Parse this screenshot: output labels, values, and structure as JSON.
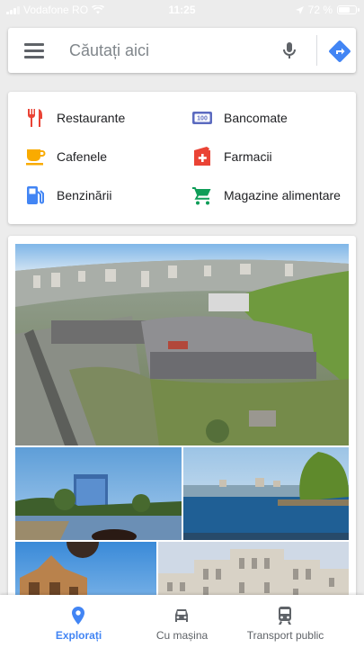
{
  "status_bar": {
    "carrier": "Vodafone RO",
    "time": "11:25",
    "battery_text": "72 %",
    "battery_level": 0.72
  },
  "search": {
    "placeholder": "Căutați aici",
    "icons": [
      "menu-icon",
      "microphone-icon",
      "directions-icon"
    ]
  },
  "categories": {
    "items": [
      {
        "label": "Restaurante",
        "icon": "restaurant-icon",
        "color": "#ea4335"
      },
      {
        "label": "Bancomate",
        "icon": "atm-icon",
        "color": "#5c6bc0"
      },
      {
        "label": "Cafenele",
        "icon": "coffee-icon",
        "color": "#f9ab00"
      },
      {
        "label": "Farmacii",
        "icon": "pharmacy-icon",
        "color": "#ea4335"
      },
      {
        "label": "Benzinării",
        "icon": "gas-station-icon",
        "color": "#4285f4"
      },
      {
        "label": "Magazine alimentare",
        "icon": "grocery-cart-icon",
        "color": "#0f9d58"
      }
    ]
  },
  "explore": {
    "photos": [
      {
        "name": "aerial-city-photo",
        "caption": ""
      },
      {
        "name": "lake-building-photo",
        "caption": ""
      },
      {
        "name": "lake-willow-photo",
        "caption": ""
      },
      {
        "name": "ornate-building-photo",
        "caption": ""
      },
      {
        "name": "palace-photo",
        "caption": ""
      }
    ]
  },
  "bottom_nav": {
    "tabs": [
      {
        "label": "Explorați",
        "icon": "location-pin-icon",
        "active": true
      },
      {
        "label": "Cu mașina",
        "icon": "car-icon",
        "active": false
      },
      {
        "label": "Transport public",
        "icon": "transit-icon",
        "active": false
      }
    ],
    "accent": "#4285f4"
  }
}
